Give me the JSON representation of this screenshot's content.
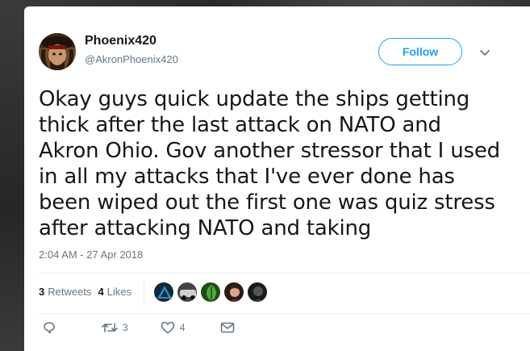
{
  "user": {
    "display_name": "Phoenix420",
    "handle": "@AkronPhoenix420"
  },
  "follow_label": "Follow",
  "tweet": {
    "text": "Okay guys quick update the ships getting thick after the last attack on NATO and Akron Ohio. Gov another stressor that I used in all my attacks that I've ever done has been wiped out the first one was quiz stress after attacking NATO and taking",
    "timestamp": "2:04 AM - 27 Apr 2018"
  },
  "stats": {
    "retweets_count": "3",
    "retweets_label": "Retweets",
    "likes_count": "4",
    "likes_label": "Likes"
  },
  "actions": {
    "reply_icon": "reply-icon",
    "retweet_icon": "retweet-icon",
    "retweet_count": "3",
    "like_icon": "heart-icon",
    "like_count": "4",
    "message_icon": "envelope-icon"
  },
  "colors": {
    "accent": "#1da1f2",
    "text": "#14171a",
    "muted": "#657786",
    "divider": "#e6ecf0"
  }
}
